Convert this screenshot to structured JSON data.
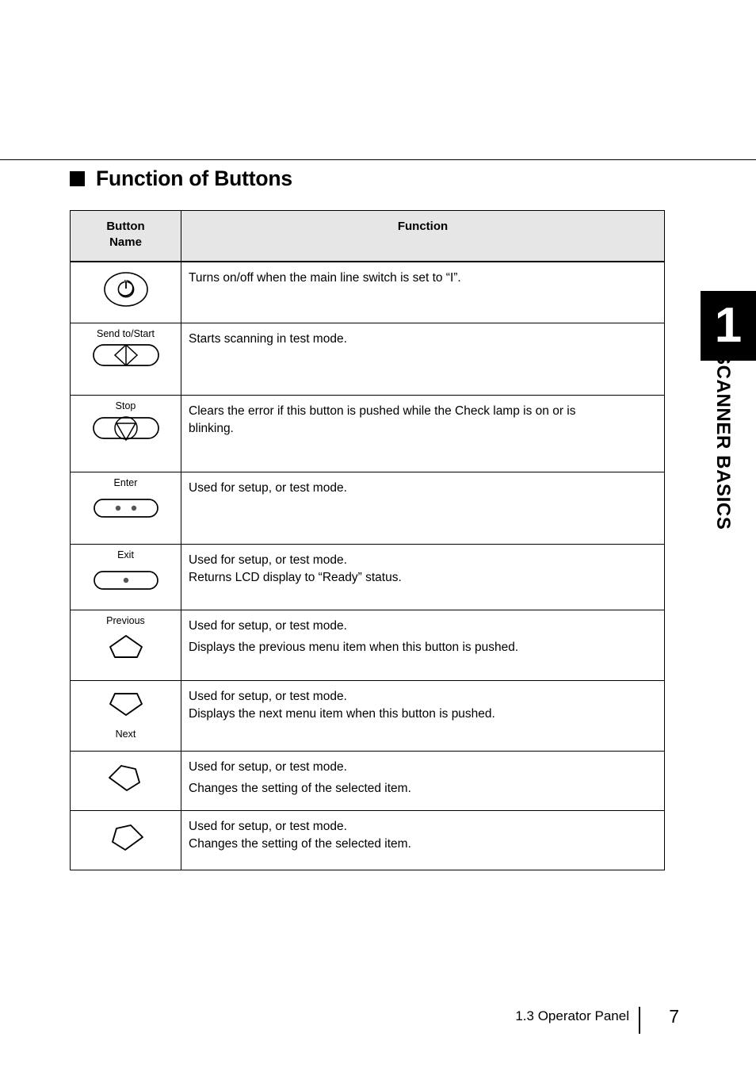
{
  "heading": {
    "bullet": "black-square-bullet",
    "text": "Function of Buttons"
  },
  "table": {
    "headers": {
      "button_name": "Button\nName",
      "button_name_line1": "Button",
      "button_name_line2": "Name",
      "function": "Function"
    },
    "rows": [
      {
        "label": "",
        "label_position": "none",
        "icon": "power-button-icon",
        "function_lines": [
          "Turns on/off when the main line switch is set to “I”."
        ]
      },
      {
        "label": "Send to/Start",
        "label_position": "above",
        "icon": "send-to-start-button-icon",
        "function_lines": [
          "Starts scanning in test mode."
        ]
      },
      {
        "label": "Stop",
        "label_position": "above",
        "icon": "stop-button-icon",
        "function_lines": [
          "Clears the error if this button is pushed while the Check lamp is on or is",
          "blinking."
        ]
      },
      {
        "label": "Enter",
        "label_position": "above",
        "icon": "enter-button-icon",
        "function_lines": [
          "Used for setup, or test mode."
        ]
      },
      {
        "label": "Exit",
        "label_position": "above",
        "icon": "exit-button-icon",
        "function_lines": [
          "Used for setup, or test mode.",
          "Returns  LCD display to “Ready” status."
        ]
      },
      {
        "label": "Previous",
        "label_position": "above",
        "icon": "previous-arrow-up-icon",
        "function_lines": [
          "Used for setup, or test mode.",
          "Displays the previous menu item when this button is pushed."
        ]
      },
      {
        "label": "Next",
        "label_position": "below",
        "icon": "next-arrow-down-icon",
        "function_lines": [
          "Used for setup, or test mode.",
          "Displays the next menu item when this button is pushed."
        ]
      },
      {
        "label": "",
        "label_position": "none",
        "icon": "arrow-left-icon",
        "function_lines": [
          "Used for setup, or test mode.",
          "Changes the setting of the selected item."
        ]
      },
      {
        "label": "",
        "label_position": "none",
        "icon": "arrow-right-icon",
        "function_lines": [
          "Used for setup, or test mode.",
          "Changes the setting of the selected item."
        ]
      }
    ]
  },
  "chapter_tab": {
    "number": "1",
    "title": "SCANNER BASICS"
  },
  "footer": {
    "section": "1.3 Operator Panel",
    "page_number": "7"
  },
  "colors": {
    "header_fill": "#e6e6e6",
    "rule": "#000000",
    "tab_fill": "#000000",
    "tab_text": "#ffffff"
  }
}
